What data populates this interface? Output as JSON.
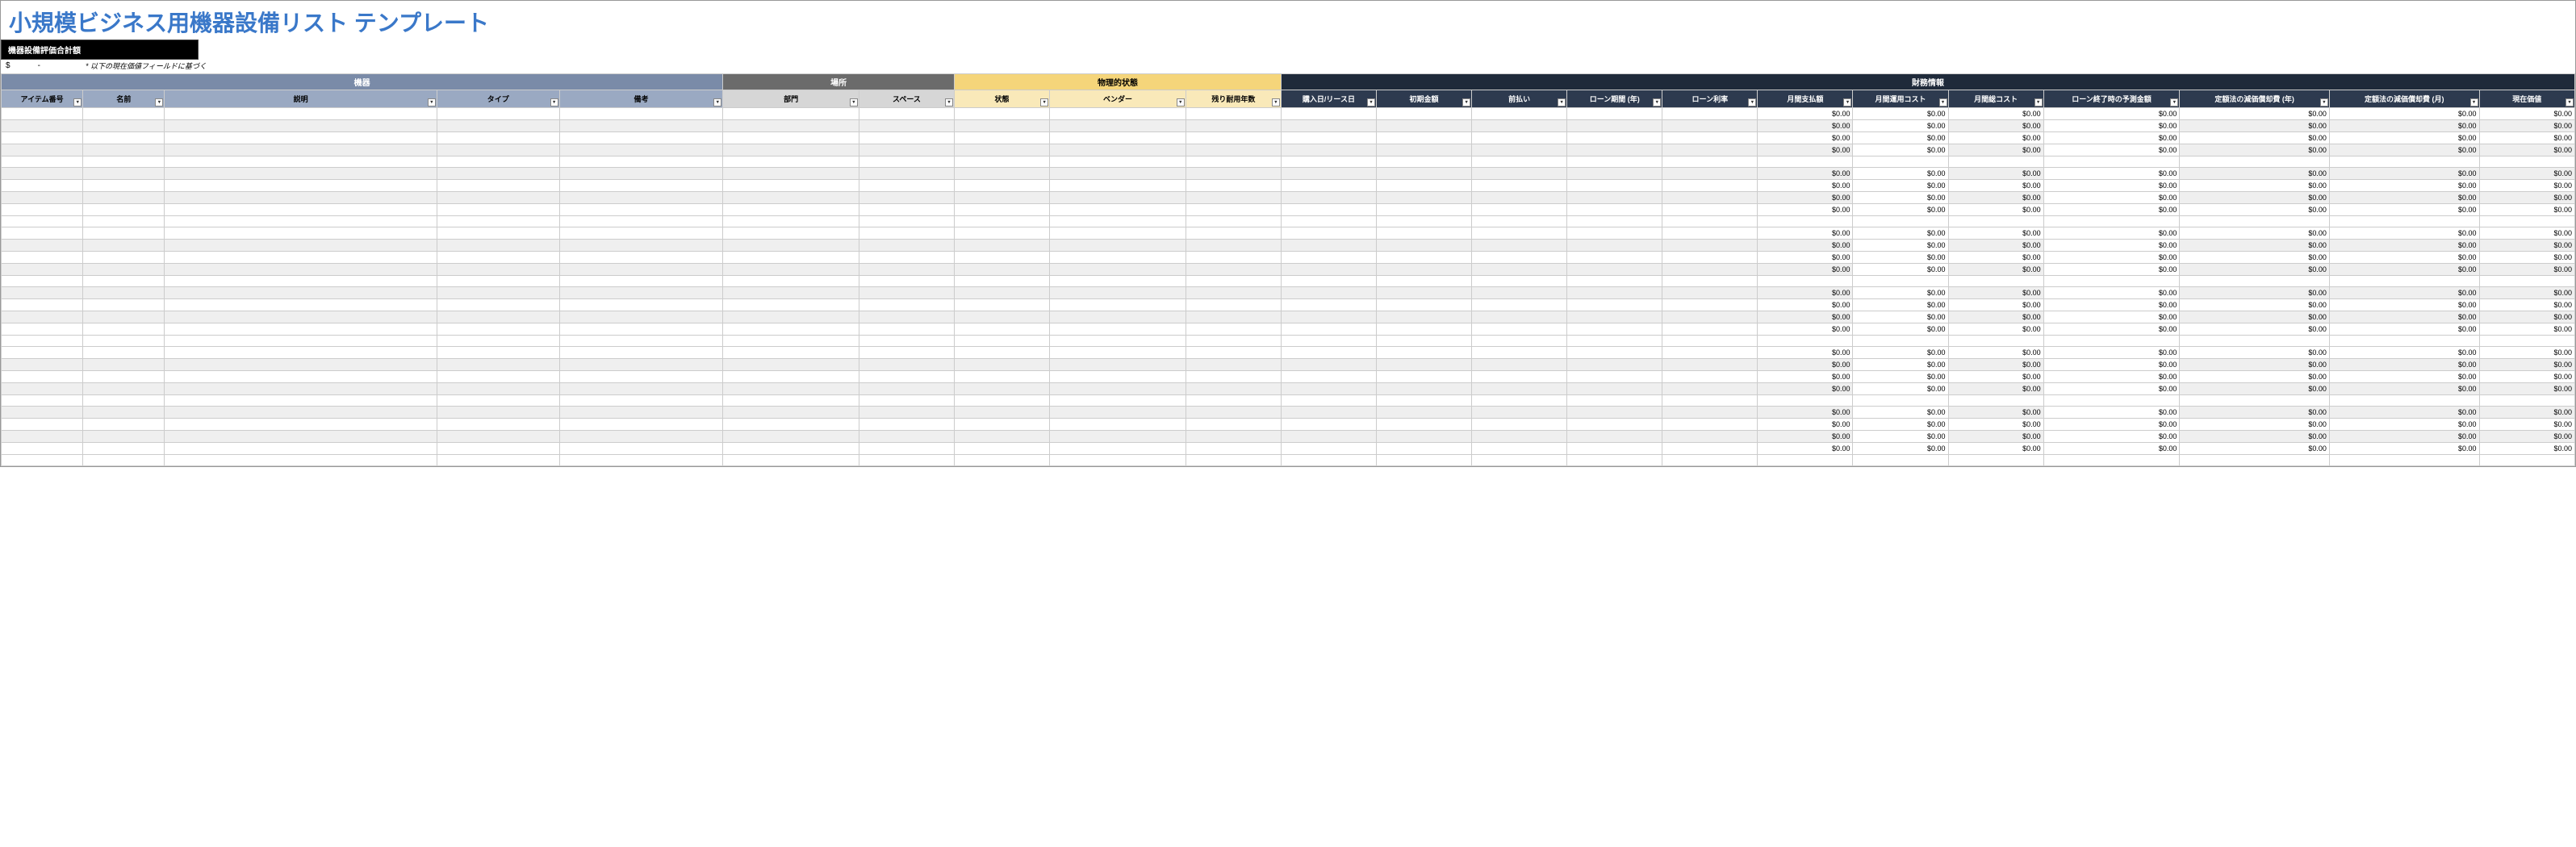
{
  "title": "小規模ビジネス用機器設備リスト テンプレート",
  "summary": {
    "label": "機器設備評価合計額",
    "currency": "$",
    "value": "-",
    "note": "* 以下の現在価値フィールドに基づく"
  },
  "groups": {
    "equipment": "機器",
    "location": "場所",
    "physical": "物理的状態",
    "financial": "財務情報"
  },
  "headers": {
    "item_no": "アイテム番号",
    "name": "名前",
    "description": "説明",
    "type": "タイプ",
    "remarks": "備考",
    "department": "部門",
    "space": "スペース",
    "condition": "状態",
    "vendor": "ベンダー",
    "remaining_life": "残り耐用年数",
    "purchase_date": "購入日/リース日",
    "initial_amount": "初期金額",
    "down_payment": "前払い",
    "loan_term": "ローン期間 (年)",
    "loan_rate": "ローン利率",
    "monthly_payment": "月間支払額",
    "monthly_op_cost": "月間運用コスト",
    "monthly_total_cost": "月間総コスト",
    "loan_end_balance": "ローン終了時の予測金額",
    "dep_year": "定額法の減価償却費 (年)",
    "dep_month": "定額法の減価償却費 (月)",
    "current_value": "現在価値"
  },
  "cell_value": "$0.00",
  "row_count": 30,
  "gap_rows": [
    4,
    9,
    14,
    19,
    24,
    29
  ]
}
